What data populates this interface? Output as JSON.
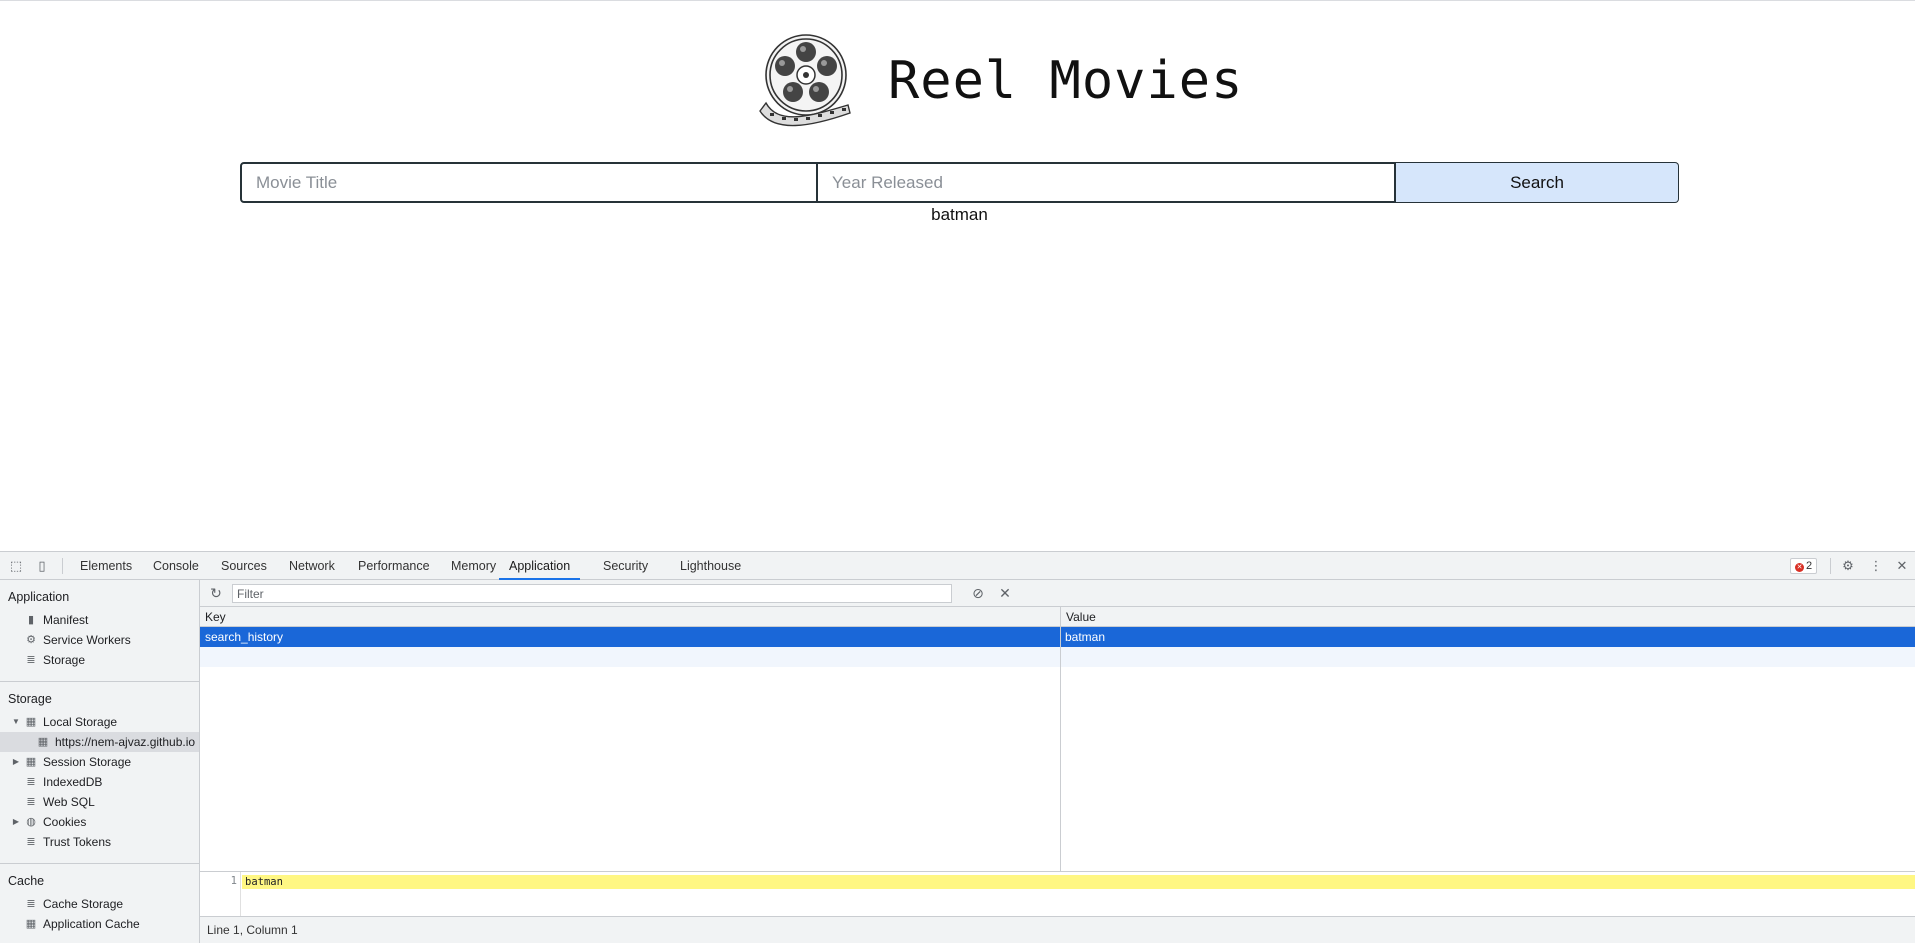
{
  "site": {
    "title": "Reel Movies",
    "logo_icon": "film-reel-icon"
  },
  "search": {
    "title_placeholder": "Movie Title",
    "year_placeholder": "Year Released",
    "title_value": "",
    "year_value": "",
    "button_label": "Search",
    "button_color": "#d6e6fb"
  },
  "history": [
    "batman"
  ],
  "devtools": {
    "tabs": [
      "Elements",
      "Console",
      "Sources",
      "Network",
      "Performance",
      "Memory",
      "Application",
      "Security",
      "Lighthouse"
    ],
    "active_tab": "Application",
    "error_count": "2",
    "sidebar": {
      "application_heading": "Application",
      "application_items": [
        "Manifest",
        "Service Workers",
        "Storage"
      ],
      "storage_heading": "Storage",
      "storage_items": [
        "Local Storage",
        "https://nem-ajvaz.github.io",
        "Session Storage",
        "IndexedDB",
        "Web SQL",
        "Cookies",
        "Trust Tokens"
      ],
      "cache_heading": "Cache",
      "cache_items": [
        "Cache Storage",
        "Application Cache"
      ]
    },
    "storage": {
      "filter_placeholder": "Filter",
      "columns": [
        "Key",
        "Value"
      ],
      "rows": [
        {
          "key": "search_history",
          "value": "batman"
        }
      ],
      "selected_row_color": "#1a67d8"
    },
    "preview": {
      "line_number": "1",
      "line_text": "batman",
      "highlight_color": "#fff783"
    },
    "status": "Line 1, Column 1"
  }
}
